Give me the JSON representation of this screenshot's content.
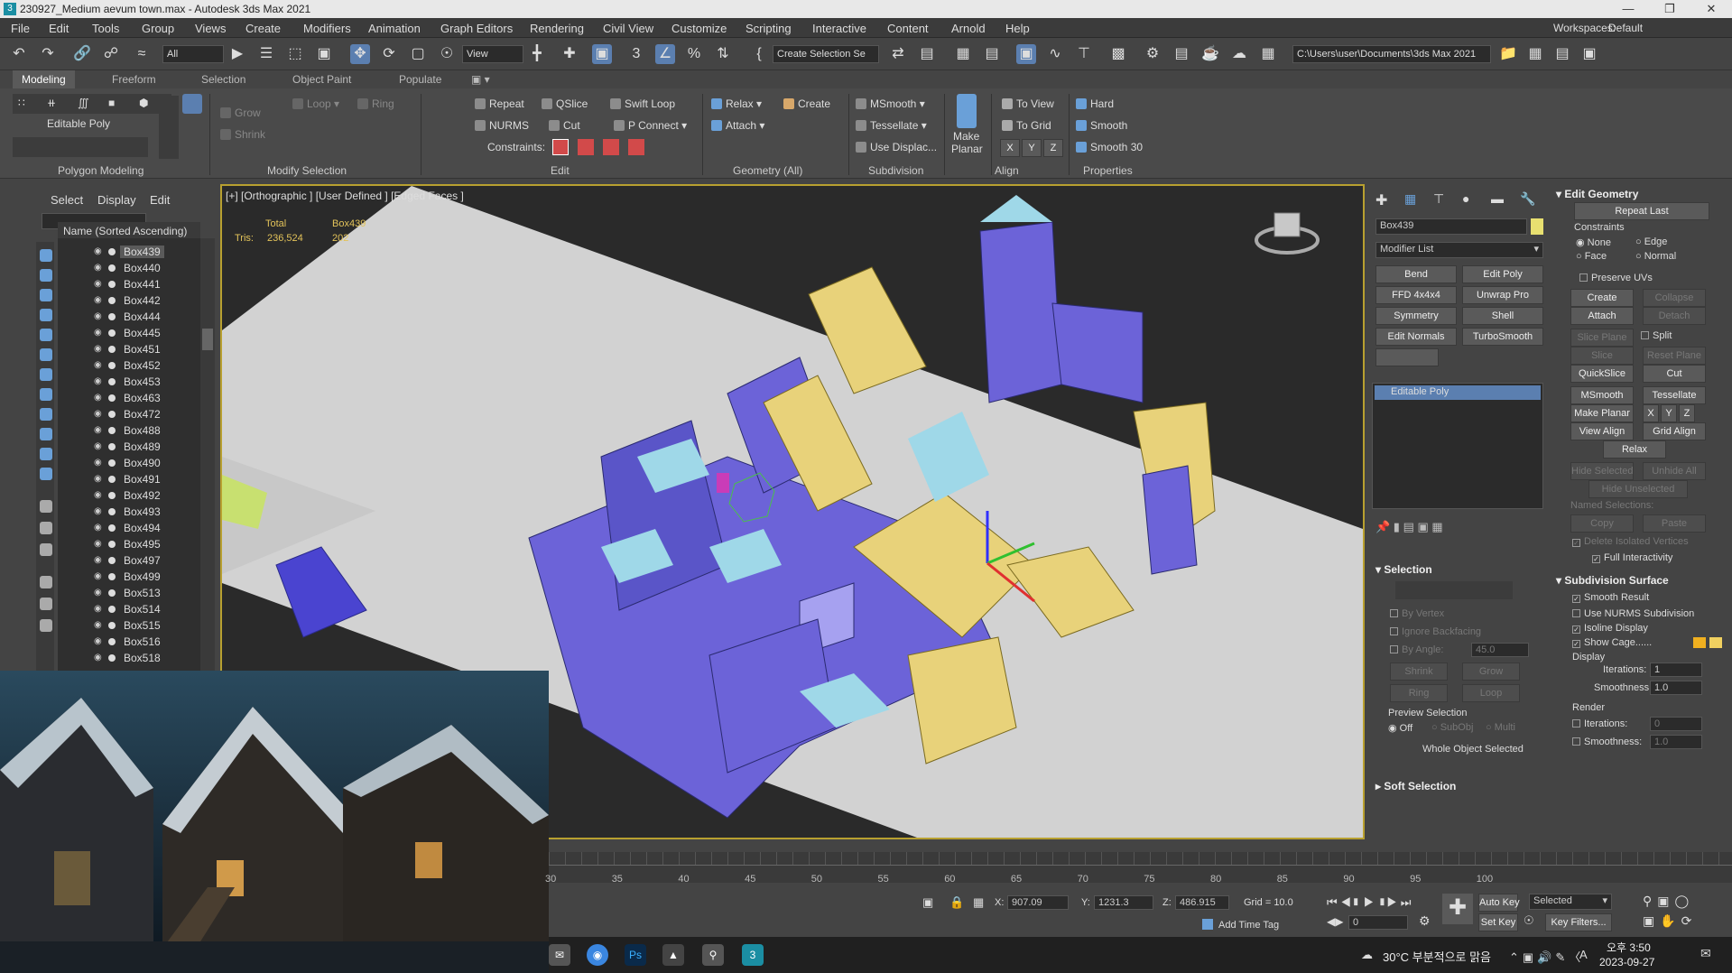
{
  "title": "230927_Medium aevum town.max - Autodesk 3ds Max 2021",
  "menu": [
    "File",
    "Edit",
    "Tools",
    "Group",
    "Views",
    "Create",
    "Modifiers",
    "Animation",
    "Graph Editors",
    "Rendering",
    "Civil View",
    "Customize",
    "Scripting",
    "Interactive",
    "Content",
    "Arnold",
    "Help"
  ],
  "workspaces_label": "Workspaces:",
  "workspace_value": "Default",
  "toolbar": {
    "filter": "All",
    "view": "View",
    "selection_set": "Create Selection Se",
    "path": "C:\\Users\\user\\Documents\\3ds Max 2021"
  },
  "ribbon_tabs": [
    "Modeling",
    "Freeform",
    "Selection",
    "Object Paint",
    "Populate"
  ],
  "ribbon": {
    "editable_poly": "Editable Poly",
    "grow": "Grow",
    "shrink": "Shrink",
    "loop": "Loop",
    "ring": "Ring",
    "repeat": "Repeat",
    "qslice": "QSlice",
    "swift_loop": "Swift Loop",
    "nurms": "NURMS",
    "cut": "Cut",
    "p_connect": "P Connect",
    "constraints": "Constraints:",
    "relax": "Relax",
    "create": "Create",
    "attach": "Attach",
    "msmooth": "MSmooth",
    "tessellate": "Tessellate",
    "use_displac": "Use Displac...",
    "make": "Make",
    "planar": "Planar",
    "to_view": "To View",
    "to_grid": "To Grid",
    "x": "X",
    "y": "Y",
    "z": "Z",
    "hard": "Hard",
    "smooth": "Smooth",
    "smooth30": "Smooth 30",
    "groups": [
      "Polygon Modeling",
      "Modify Selection",
      "Edit",
      "Geometry (All)",
      "Subdivision",
      "Align",
      "Properties"
    ]
  },
  "scene_explorer": {
    "tabs": [
      "Select",
      "Display",
      "Edit"
    ],
    "column": "Name (Sorted Ascending)",
    "items": [
      "Box439",
      "Box440",
      "Box441",
      "Box442",
      "Box444",
      "Box445",
      "Box451",
      "Box452",
      "Box453",
      "Box463",
      "Box472",
      "Box488",
      "Box489",
      "Box490",
      "Box491",
      "Box492",
      "Box493",
      "Box494",
      "Box495",
      "Box497",
      "Box499",
      "Box513",
      "Box514",
      "Box515",
      "Box516",
      "Box518"
    ]
  },
  "viewport": {
    "label": "[+] [Orthographic ] [User Defined ] [Edged Faces ]",
    "total": "Total",
    "obj": "Box439",
    "tris_label": "Tris:",
    "tris_total": "236,524",
    "tris_obj": "202"
  },
  "command_panel": {
    "object_name": "Box439",
    "modifier_list": "Modifier List",
    "modifiers": [
      "Bend",
      "Edit Poly",
      "FFD 4x4x4",
      "Unwrap Pro",
      "Symmetry",
      "Shell",
      "Edit Normals",
      "TurboSmooth"
    ],
    "stack_item": "Editable Poly",
    "selection": "Selection",
    "by_vertex": "By Vertex",
    "ignore_backfacing": "Ignore Backfacing",
    "by_angle": "By Angle:",
    "angle_value": "45.0",
    "shrink": "Shrink",
    "grow": "Grow",
    "ring": "Ring",
    "loop": "Loop",
    "preview_selection": "Preview Selection",
    "off": "Off",
    "subobj": "SubObj",
    "multi": "Multi",
    "whole_object": "Whole Object Selected",
    "soft_selection": "Soft Selection"
  },
  "edit_geometry": {
    "title": "Edit Geometry",
    "repeat_last": "Repeat Last",
    "constraints": "Constraints",
    "none": "None",
    "edge": "Edge",
    "face": "Face",
    "normal": "Normal",
    "preserve_uvs": "Preserve UVs",
    "create": "Create",
    "collapse": "Collapse",
    "attach": "Attach",
    "detach": "Detach",
    "slice_plane": "Slice Plane",
    "split": "Split",
    "slice": "Slice",
    "reset_plane": "Reset Plane",
    "quickslice": "QuickSlice",
    "cut": "Cut",
    "msmooth": "MSmooth",
    "tessellate": "Tessellate",
    "make_planar": "Make Planar",
    "x": "X",
    "y": "Y",
    "z": "Z",
    "view_align": "View Align",
    "grid_align": "Grid Align",
    "relax": "Relax",
    "hide_selected": "Hide Selected",
    "unhide_all": "Unhide All",
    "hide_unselected": "Hide Unselected",
    "named_selections": "Named Selections:",
    "copy": "Copy",
    "paste": "Paste",
    "delete_isolated": "Delete Isolated Vertices",
    "full_interactivity": "Full Interactivity"
  },
  "subdivision": {
    "title": "Subdivision Surface",
    "smooth_result": "Smooth Result",
    "use_nurms": "Use NURMS Subdivision",
    "isoline": "Isoline Display",
    "show_cage": "Show Cage......",
    "display": "Display",
    "iterations": "Iterations:",
    "iter_val": "1",
    "smoothness": "Smoothness:",
    "smooth_val": "1.0",
    "render": "Render",
    "r_iter_val": "0",
    "r_smooth_val": "1.0"
  },
  "timeline_ticks": [
    "30",
    "35",
    "40",
    "45",
    "50",
    "55",
    "60",
    "65",
    "70",
    "75",
    "80",
    "85",
    "90",
    "95",
    "100"
  ],
  "status": {
    "x_label": "X:",
    "x": "907.09",
    "y_label": "Y:",
    "y": "1231.3",
    "z_label": "Z:",
    "z": "486.915",
    "grid": "Grid = 10.0",
    "add_time_tag": "Add Time Tag",
    "auto_key": "Auto Key",
    "selected": "Selected",
    "set_key": "Set Key",
    "key_filters": "Key Filters...",
    "frame": "0"
  },
  "taskbar": {
    "weather": "30°C 부분적으로 맑음",
    "time": "오후 3:50",
    "date": "2023-09-27",
    "ime": "A"
  },
  "colors": {
    "accent": "#b8a030",
    "poly": "#6c63d8",
    "roof": "#e8d27a",
    "ground": "#d2d2d2"
  }
}
